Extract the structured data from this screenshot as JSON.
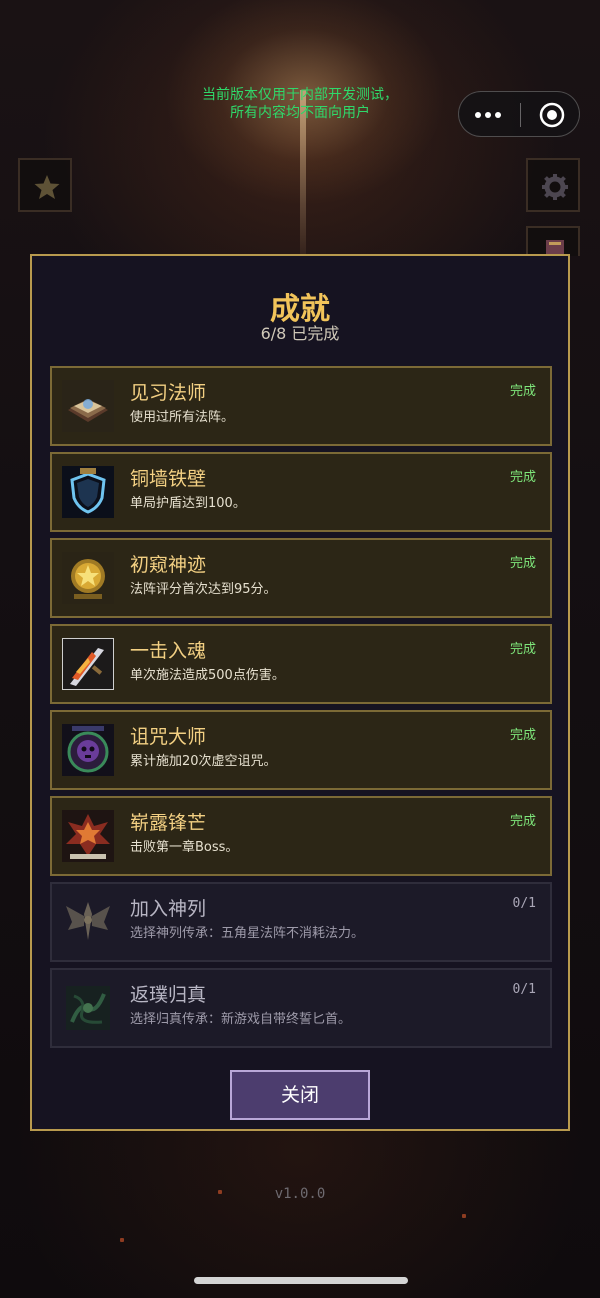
{
  "dev_notice": {
    "line1": "当前版本仅用于内部开发测试，",
    "line2": "所有内容均不面向用户"
  },
  "top_icons": {
    "left": "star-icon",
    "right_top": "gear-icon",
    "right_bottom": "book-icon"
  },
  "panel": {
    "title": "成就",
    "progress": "6/8 已完成",
    "close_label": "关闭"
  },
  "achievements": [
    {
      "name": "见习法师",
      "desc": "使用过所有法阵。",
      "status": "完成",
      "icon": "spellbook-icon",
      "completed": true
    },
    {
      "name": "铜墙铁壁",
      "desc": "单局护盾达到100。",
      "status": "完成",
      "icon": "shield-icon",
      "completed": true
    },
    {
      "name": "初窥神迹",
      "desc": "法阵评分首次达到95分。",
      "status": "完成",
      "icon": "gold-star-medal-icon",
      "completed": true
    },
    {
      "name": "一击入魂",
      "desc": "单次施法造成500点伤害。",
      "status": "完成",
      "icon": "flaming-sword-icon",
      "completed": true
    },
    {
      "name": "诅咒大师",
      "desc": "累计施加20次虚空诅咒。",
      "status": "完成",
      "icon": "curse-skull-emblem-icon",
      "completed": true
    },
    {
      "name": "崭露锋芒",
      "desc": "击败第一章Boss。",
      "status": "完成",
      "icon": "boss-slayer-badge-icon",
      "completed": true
    },
    {
      "name": "加入神列",
      "desc": "选择神列传承：五角星法阵不消耗法力。",
      "status": "0/1",
      "icon": "winged-emblem-icon",
      "completed": false
    },
    {
      "name": "返璞归真",
      "desc": "选择归真传承：新游戏自带终誓匕首。",
      "status": "0/1",
      "icon": "green-vine-emblem-icon",
      "completed": false
    }
  ],
  "version": "v1.0.0",
  "colors": {
    "title_gold": "#f2c45a",
    "status_done_green": "#7ee57a",
    "panel_border_gold": "#b89a4e",
    "dev_notice_green": "#2fd86a",
    "close_button_purple": "#4c3d6e"
  }
}
